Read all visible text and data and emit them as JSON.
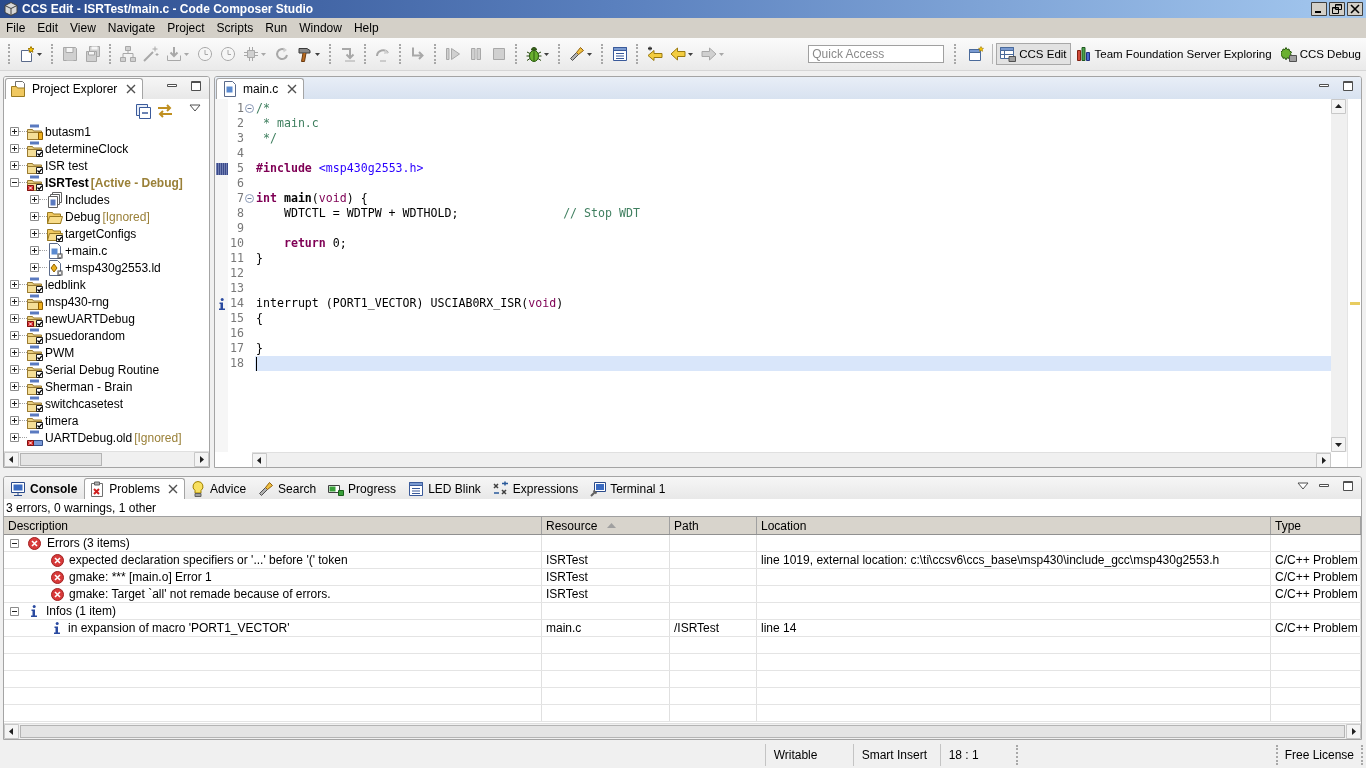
{
  "window": {
    "title": "CCS Edit - ISRTest/main.c - Code Composer Studio"
  },
  "menu": [
    "File",
    "Edit",
    "View",
    "Navigate",
    "Project",
    "Scripts",
    "Run",
    "Window",
    "Help"
  ],
  "toolbar": {
    "groups": [
      [
        {
          "kind": "new",
          "disabled": false,
          "dropdown": true
        }
      ],
      [
        {
          "kind": "save",
          "disabled": true
        },
        {
          "kind": "save-all",
          "disabled": true
        }
      ],
      [
        {
          "kind": "build-config",
          "disabled": true
        },
        {
          "kind": "wand",
          "disabled": true
        },
        {
          "kind": "download",
          "disabled": true,
          "dropdown": true
        },
        {
          "kind": "clock",
          "disabled": true
        },
        {
          "kind": "clock",
          "disabled": true
        },
        {
          "kind": "chip",
          "disabled": true,
          "dropdown": true
        },
        {
          "kind": "restart",
          "disabled": true
        },
        {
          "kind": "hammer",
          "disabled": false,
          "dropdown": true
        }
      ],
      [
        {
          "kind": "step-into",
          "disabled": true
        }
      ],
      [
        {
          "kind": "step-over",
          "disabled": true
        }
      ],
      [
        {
          "kind": "step-return",
          "disabled": true
        }
      ],
      [
        {
          "kind": "resume",
          "disabled": true
        },
        {
          "kind": "suspend",
          "disabled": true
        },
        {
          "kind": "terminate",
          "disabled": true
        }
      ],
      [
        {
          "kind": "bug",
          "disabled": false,
          "dropdown": true
        }
      ],
      [
        {
          "kind": "flashlight",
          "disabled": false,
          "dropdown": true
        }
      ],
      [
        {
          "kind": "view",
          "disabled": false
        }
      ],
      [
        {
          "kind": "last-edit",
          "disabled": false
        },
        {
          "kind": "back",
          "disabled": false,
          "dropdown": true
        },
        {
          "kind": "forward",
          "disabled": true,
          "dropdown": true
        }
      ]
    ],
    "quick_access": {
      "placeholder": "Quick Access"
    },
    "perspectives": [
      {
        "label": "CCS Edit",
        "kind": "edit",
        "selected": true
      },
      {
        "label": "Team Foundation Server Exploring",
        "kind": "tfs",
        "selected": false
      },
      {
        "label": "CCS Debug",
        "kind": "debug",
        "selected": false
      }
    ]
  },
  "project_explorer": {
    "title": "Project Explorer",
    "items": [
      {
        "label": "butasm1",
        "kind": "ccs-project",
        "expanded": false,
        "active": false,
        "errors": false,
        "checked": false,
        "pending": true,
        "closed": false
      },
      {
        "label": "determineClock",
        "kind": "ccs-project",
        "expanded": false,
        "active": false,
        "errors": false,
        "checked": true,
        "pending": false,
        "closed": false
      },
      {
        "label": "ISR test",
        "kind": "project",
        "expanded": false,
        "active": false,
        "errors": false,
        "checked": true,
        "pending": false,
        "closed": false
      },
      {
        "label": "ISRTest",
        "note": "[Active - Debug]",
        "kind": "ccs-project",
        "expanded": true,
        "active": true,
        "errors": true,
        "checked": true,
        "pending": false,
        "closed": false,
        "children": [
          {
            "label": "Includes",
            "kind": "includes",
            "expanded": false,
            "checked": false,
            "added": false
          },
          {
            "label": "Debug",
            "note": "[Ignored]",
            "kind": "folder",
            "expanded": false,
            "checked": false,
            "added": false
          },
          {
            "label": "targetConfigs",
            "kind": "folder",
            "expanded": false,
            "checked": true,
            "added": false
          },
          {
            "label": "+main.c",
            "kind": "c-file",
            "expanded": false,
            "checked": false,
            "added": true
          },
          {
            "label": "+msp430g2553.ld",
            "kind": "linker-file",
            "expanded": false,
            "checked": false,
            "added": true
          }
        ]
      },
      {
        "label": "ledblink",
        "kind": "ccs-project",
        "expanded": false,
        "active": false,
        "errors": false,
        "checked": true,
        "pending": false,
        "closed": false
      },
      {
        "label": "msp430-rng",
        "kind": "ccs-project",
        "expanded": false,
        "active": false,
        "errors": false,
        "checked": false,
        "pending": true,
        "closed": false
      },
      {
        "label": "newUARTDebug",
        "kind": "ccs-project",
        "expanded": false,
        "active": false,
        "errors": true,
        "checked": true,
        "pending": false,
        "closed": false
      },
      {
        "label": "psuedorandom",
        "kind": "ccs-project",
        "expanded": false,
        "active": false,
        "errors": false,
        "checked": true,
        "pending": false,
        "closed": false
      },
      {
        "label": "PWM",
        "kind": "ccs-project",
        "expanded": false,
        "active": false,
        "errors": false,
        "checked": true,
        "pending": false,
        "closed": false
      },
      {
        "label": "Serial Debug Routine",
        "kind": "ccs-project",
        "expanded": false,
        "active": false,
        "errors": false,
        "checked": true,
        "pending": false,
        "closed": false
      },
      {
        "label": "Sherman - Brain",
        "kind": "ccs-project",
        "expanded": false,
        "active": false,
        "errors": false,
        "checked": true,
        "pending": false,
        "closed": false
      },
      {
        "label": "switchcasetest",
        "kind": "ccs-project",
        "expanded": false,
        "active": false,
        "errors": false,
        "checked": true,
        "pending": false,
        "closed": false
      },
      {
        "label": "timera",
        "kind": "ccs-project",
        "expanded": false,
        "active": false,
        "errors": false,
        "checked": true,
        "pending": false,
        "closed": false
      },
      {
        "label": "UARTDebug.old",
        "note": "[Ignored]",
        "kind": "ccs-project",
        "expanded": false,
        "active": false,
        "errors": true,
        "checked": false,
        "pending": false,
        "closed": true
      }
    ]
  },
  "editor": {
    "tabs": [
      {
        "label": "main.c",
        "selected": true
      }
    ],
    "lines": [
      {
        "number": "1",
        "fold": true,
        "current": false,
        "tokens": [
          {
            "kind": "comment",
            "text": "/*"
          }
        ]
      },
      {
        "number": "2",
        "fold": false,
        "current": false,
        "tokens": [
          {
            "kind": "comment",
            "text": " * main.c"
          }
        ]
      },
      {
        "number": "3",
        "fold": false,
        "current": false,
        "tokens": [
          {
            "kind": "comment",
            "text": " */"
          }
        ]
      },
      {
        "number": "4",
        "fold": false,
        "current": false
      },
      {
        "number": "5",
        "fold": false,
        "marker": {
          "kind": "occurrence"
        },
        "current": false,
        "tokens": [
          {
            "kind": "directive",
            "text": "#include "
          },
          {
            "kind": "header",
            "text": "<msp430g2553.h>"
          }
        ]
      },
      {
        "number": "6",
        "fold": false,
        "current": false
      },
      {
        "number": "7",
        "fold": true,
        "current": false,
        "tokens": [
          {
            "kind": "keyword",
            "text": "int "
          },
          {
            "kind": "function",
            "text": "main"
          },
          {
            "kind": "plain",
            "text": "("
          },
          {
            "kind": "type",
            "text": "void"
          },
          {
            "kind": "plain",
            "text": ") {"
          }
        ]
      },
      {
        "number": "8",
        "fold": false,
        "current": false,
        "tokens": [
          {
            "kind": "plain",
            "text": "    WDTCTL = WDTPW + WDTHOLD;               "
          },
          {
            "kind": "comment",
            "text": "// Stop WDT"
          }
        ]
      },
      {
        "number": "9",
        "fold": false,
        "current": false
      },
      {
        "number": "10",
        "fold": false,
        "current": false,
        "tokens": [
          {
            "kind": "keyword",
            "text": "    return"
          },
          {
            "kind": "plain",
            "text": " 0;"
          }
        ]
      },
      {
        "number": "11",
        "fold": false,
        "current": false,
        "tokens": [
          {
            "kind": "plain",
            "text": "}"
          }
        ]
      },
      {
        "number": "12",
        "fold": false,
        "current": false
      },
      {
        "number": "13",
        "fold": false,
        "current": false
      },
      {
        "number": "14",
        "fold": false,
        "marker": {
          "kind": "info"
        },
        "current": false,
        "tokens": [
          {
            "kind": "plain",
            "text": "interrupt (PORT1_VECTOR) USCIAB0RX_ISR("
          },
          {
            "kind": "type",
            "text": "void"
          },
          {
            "kind": "plain",
            "text": ")"
          }
        ]
      },
      {
        "number": "15",
        "fold": false,
        "current": false,
        "tokens": [
          {
            "kind": "plain",
            "text": "{"
          }
        ]
      },
      {
        "number": "16",
        "fold": false,
        "current": false
      },
      {
        "number": "17",
        "fold": false,
        "current": false,
        "tokens": [
          {
            "kind": "plain",
            "text": "}"
          }
        ]
      },
      {
        "number": "18",
        "fold": false,
        "current": true
      }
    ]
  },
  "bottom_panel": {
    "tabs": [
      {
        "label": "Console",
        "kind": "console",
        "selected": false,
        "updated": true
      },
      {
        "label": "Problems",
        "kind": "problems",
        "selected": true,
        "updated": false
      },
      {
        "label": "Advice",
        "kind": "advice",
        "selected": false,
        "updated": false
      },
      {
        "label": "Search",
        "kind": "search",
        "selected": false,
        "updated": false
      },
      {
        "label": "Progress",
        "kind": "progress",
        "selected": false,
        "updated": false
      },
      {
        "label": "LED Blink",
        "kind": "view",
        "selected": false,
        "updated": false
      },
      {
        "label": "Expressions",
        "kind": "expressions",
        "selected": false,
        "updated": false
      },
      {
        "label": "Terminal 1",
        "kind": "terminal",
        "selected": false,
        "updated": false
      }
    ],
    "summary": "3 errors, 0 warnings, 1 other",
    "columns": [
      {
        "label": "Description",
        "sorted": false
      },
      {
        "label": "Resource",
        "sorted": true
      },
      {
        "label": "Path",
        "sorted": false
      },
      {
        "label": "Location",
        "sorted": false
      },
      {
        "label": "Type",
        "sorted": false
      }
    ],
    "groups": [
      {
        "label": "Errors (3 items)",
        "kind": "error",
        "expanded": true,
        "rows": [
          {
            "kind": "error",
            "description": "expected declaration specifiers or '...' before '(' token",
            "resource": "ISRTest",
            "location": "line 1019, external location: c:\\ti\\ccsv6\\ccs_base\\msp430\\include_gcc\\msp430g2553.h",
            "type": "C/C++ Problem"
          },
          {
            "kind": "error",
            "description": "gmake: *** [main.o] Error 1",
            "resource": "ISRTest",
            "type": "C/C++ Problem"
          },
          {
            "kind": "error",
            "description": "gmake: Target `all' not remade because of errors.",
            "resource": "ISRTest",
            "type": "C/C++ Problem"
          }
        ]
      },
      {
        "label": "Infos (1 item)",
        "kind": "info",
        "expanded": true,
        "rows": [
          {
            "kind": "info",
            "description": "in expansion of macro 'PORT1_VECTOR'",
            "resource": "main.c",
            "path": "/ISRTest",
            "location": "line 14",
            "type": "C/C++ Problem"
          }
        ]
      }
    ]
  },
  "status_bar": {
    "fields": [
      "Writable",
      "Smart Insert",
      "18 : 1"
    ],
    "license": "Free License"
  }
}
